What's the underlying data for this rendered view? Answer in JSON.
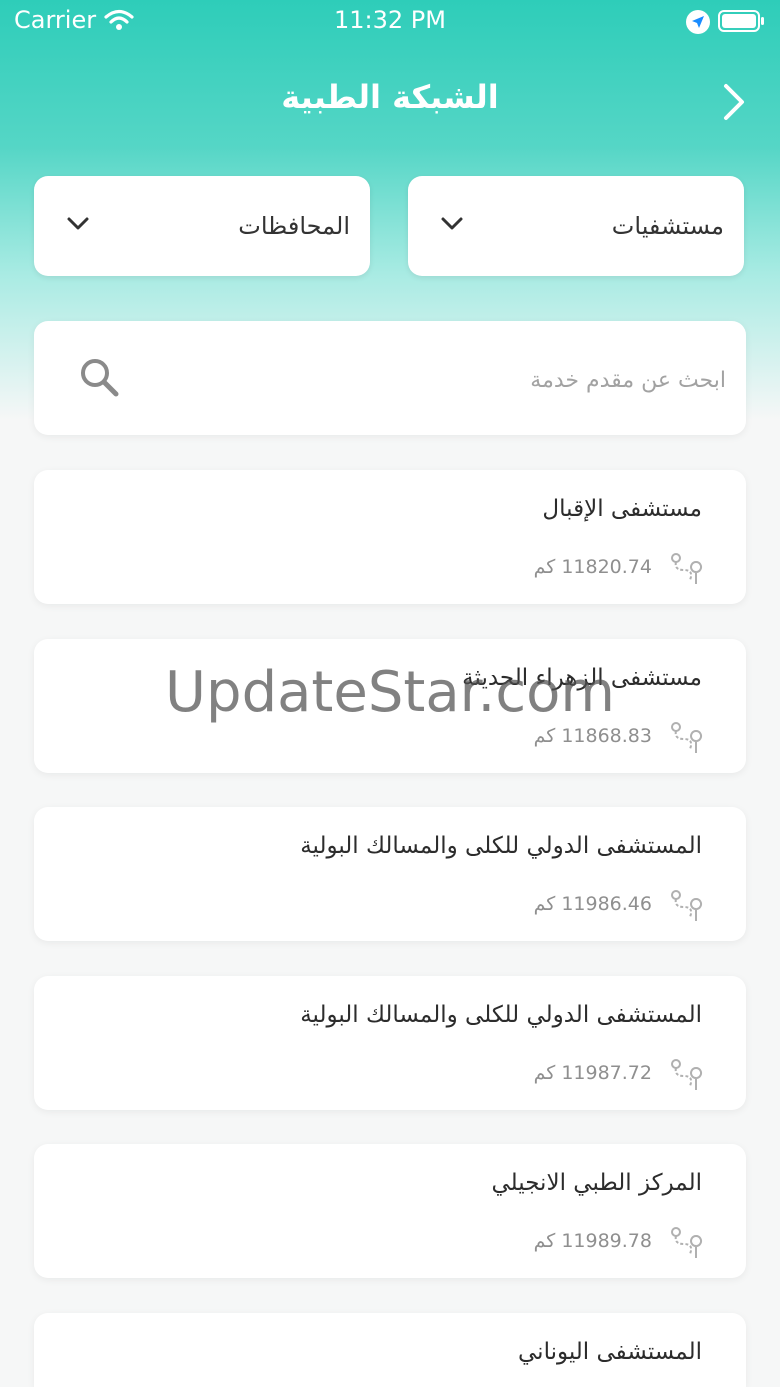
{
  "status_bar": {
    "carrier": "Carrier",
    "time": "11:32 PM"
  },
  "nav": {
    "title": "الشبكة الطبية"
  },
  "filters": {
    "category": "مستشفيات",
    "region": "المحافظات"
  },
  "search": {
    "placeholder": "ابحث عن مقدم خدمة"
  },
  "providers": [
    {
      "name": "مستشفى الإقبال",
      "distance": "11820.74 كم"
    },
    {
      "name": "مستشفى الزهراء الحديثة",
      "distance": "11868.83 كم"
    },
    {
      "name": "المستشفى الدولي للكلى والمسالك البولية",
      "distance": "11986.46 كم"
    },
    {
      "name": "المستشفى الدولي للكلى والمسالك البولية",
      "distance": "11987.72 كم"
    },
    {
      "name": "المركز الطبي الانجيلي",
      "distance": "11989.78 كم"
    },
    {
      "name": "المستشفى اليوناني",
      "distance": ""
    }
  ],
  "watermark": "UpdateStar.com",
  "colors": {
    "accent": "#2ecdb9",
    "location_icon": "#1a8cff"
  },
  "icons": {
    "back": "chevron-right-icon",
    "dropdown": "chevron-down-icon",
    "search": "search-icon",
    "distance": "route-map-icon"
  }
}
